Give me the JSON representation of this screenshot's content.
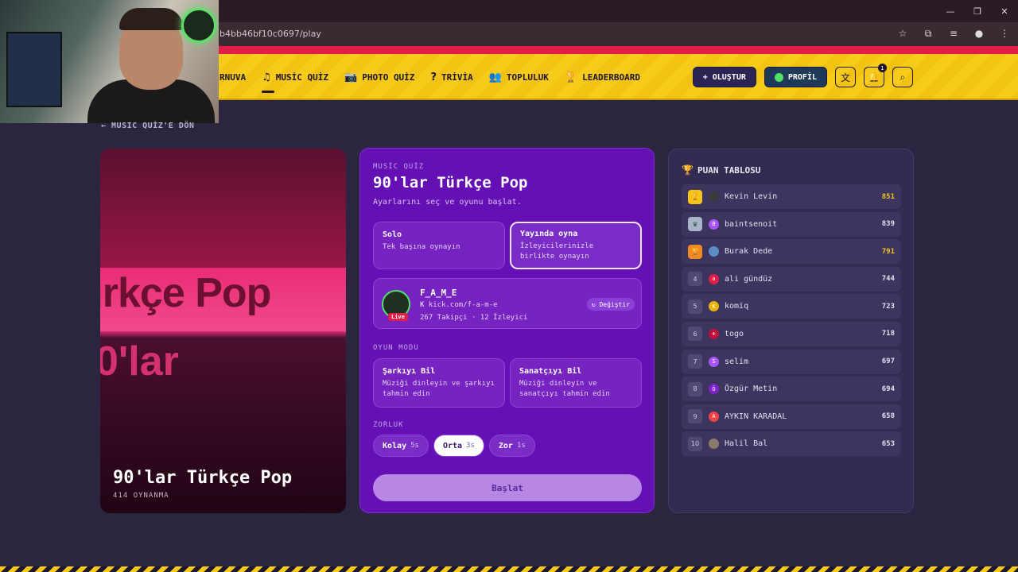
{
  "browser": {
    "url": "b4bb46bf10c0697/play",
    "controls": [
      "—",
      "❐",
      "✕"
    ],
    "addr_icons": [
      "☆",
      "⧉",
      "≡",
      "●",
      "⋮"
    ]
  },
  "nav": {
    "items": [
      {
        "label": "RNUVA",
        "icon": "",
        "active": false
      },
      {
        "label": "MUSİC QUİZ",
        "icon": "♫",
        "active": true
      },
      {
        "label": "PHOTO QUİZ",
        "icon": "📷",
        "active": false
      },
      {
        "label": "TRİVİA",
        "icon": "?",
        "active": false
      },
      {
        "label": "TOPLULUK",
        "icon": "👥",
        "active": false
      },
      {
        "label": "LEADERBOARD",
        "icon": "🏆",
        "active": false
      }
    ],
    "create_label": "+ OLUŞTUR",
    "profile_label": "PROFİL",
    "notification_count": "1"
  },
  "back_link": "← MUSIC QUİZ'E DÖN",
  "cover": {
    "big_line1": "ürkçe Pop",
    "big_line2": "0'lar",
    "title": "90'lar Türkçe Pop",
    "plays": "414 OYNANMA"
  },
  "quiz": {
    "label": "MUSİC QUİZ",
    "title": "90'lar Türkçe Pop",
    "subtitle": "Ayarlarını seç ve oyunu başlat.",
    "options": [
      {
        "title": "Solo",
        "desc": "Tek başına oynayın",
        "selected": false
      },
      {
        "title": "Yayında oyna",
        "desc": "İzleyicilerinizle birlikte oynayın",
        "selected": true
      }
    ],
    "channel": {
      "name": "F_A_M_E",
      "url": "kick.com/f-a-m-e",
      "stats": "267 Takipçi · 12 İzleyici",
      "live": "Live",
      "change": "↻ Değiştir"
    },
    "mode_label": "OYUN MODU",
    "modes": [
      {
        "title": "Şarkıyı Bil",
        "desc": "Müziği dinleyin ve şarkıyı tahmin edin"
      },
      {
        "title": "Sanatçıyı Bil",
        "desc": "Müziği dinleyin ve sanatçıyı tahmin edin"
      }
    ],
    "difficulty_label": "ZORLUK",
    "difficulties": [
      {
        "label": "Kolay",
        "time": "5s",
        "selected": false
      },
      {
        "label": "Orta",
        "time": "3s",
        "selected": true
      },
      {
        "label": "Zor",
        "time": "1s",
        "selected": false
      }
    ],
    "start_label": "Başlat"
  },
  "leaderboard": {
    "title": "PUAN TABLOSU",
    "rows": [
      {
        "rank": "🏆",
        "initial": "",
        "name": "Kevin Levin",
        "score": "851",
        "color": "#3a3a3a",
        "highlight": true,
        "medal": "gold"
      },
      {
        "rank": "♛",
        "initial": "B",
        "name": "baintsenoit",
        "score": "839",
        "color": "#a855f7",
        "highlight": false,
        "medal": "silver"
      },
      {
        "rank": "🏆",
        "initial": "",
        "name": "Burak Dede",
        "score": "791",
        "color": "#5b8dc8",
        "highlight": true,
        "medal": "bronze"
      },
      {
        "rank": "4",
        "initial": "a",
        "name": "ali gündüz",
        "score": "744",
        "color": "#e11d48",
        "highlight": false,
        "medal": ""
      },
      {
        "rank": "5",
        "initial": "K",
        "name": "komiq",
        "score": "723",
        "color": "#eab308",
        "highlight": false,
        "medal": ""
      },
      {
        "rank": "6",
        "initial": "✣",
        "name": "togo",
        "score": "718",
        "color": "#be123c",
        "highlight": false,
        "medal": ""
      },
      {
        "rank": "7",
        "initial": "S",
        "name": "selim",
        "score": "697",
        "color": "#a855f7",
        "highlight": false,
        "medal": ""
      },
      {
        "rank": "8",
        "initial": "Ö",
        "name": "Özgür Metin",
        "score": "694",
        "color": "#7e22ce",
        "highlight": false,
        "medal": ""
      },
      {
        "rank": "9",
        "initial": "A",
        "name": "AYKIN KARADAL",
        "score": "658",
        "color": "#ef4444",
        "highlight": false,
        "medal": ""
      },
      {
        "rank": "10",
        "initial": "",
        "name": "Halil Bal",
        "score": "653",
        "color": "#8a7a6c",
        "highlight": false,
        "medal": ""
      }
    ]
  }
}
